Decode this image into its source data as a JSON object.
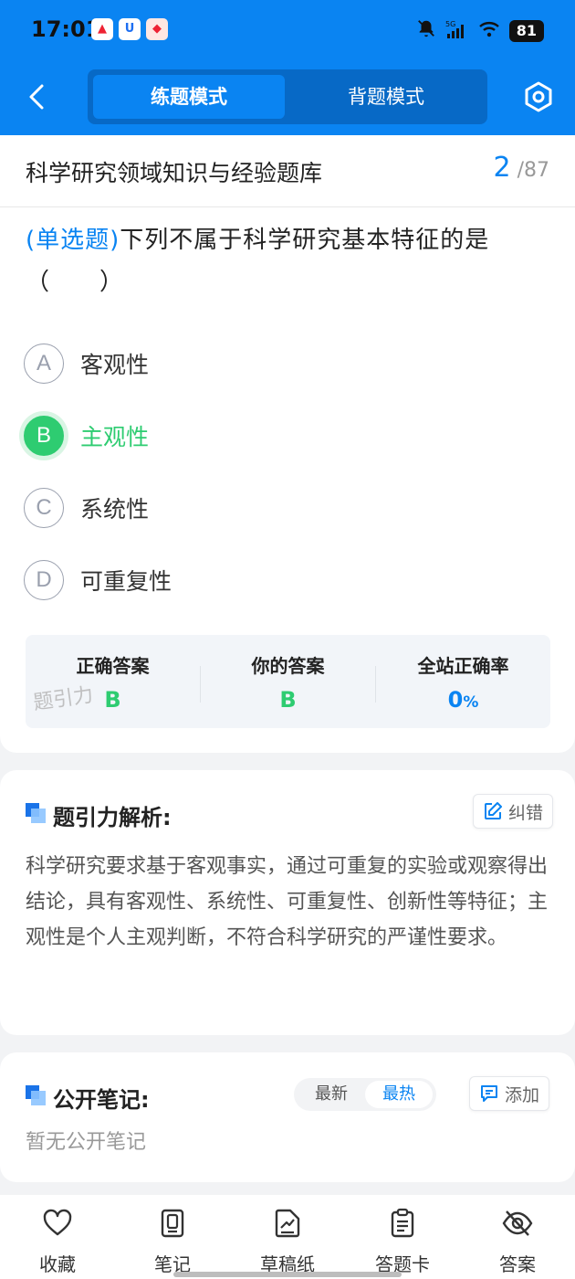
{
  "status": {
    "time": "17:01",
    "battery": "81",
    "network": "5G"
  },
  "header": {
    "tab_practice": "练题模式",
    "tab_memorize": "背题模式"
  },
  "bank": {
    "title": "科学研究领域知识与经验题库",
    "current": "2",
    "total": "87"
  },
  "question": {
    "type": "(单选题)",
    "text": "下列不属于科学研究基本特征的是（　　）",
    "options": [
      {
        "letter": "A",
        "text": "客观性"
      },
      {
        "letter": "B",
        "text": "主观性"
      },
      {
        "letter": "C",
        "text": "系统性"
      },
      {
        "letter": "D",
        "text": "可重复性"
      }
    ]
  },
  "answer": {
    "correct_label": "正确答案",
    "correct_value": "B",
    "yours_label": "你的答案",
    "yours_value": "B",
    "rate_label": "全站正确率",
    "rate_value": "0",
    "rate_unit": "%",
    "watermark": "题引力"
  },
  "analysis": {
    "title": "题引力解析:",
    "report_label": "纠错",
    "text": "科学研究要求基于客观事实，通过可重复的实验或观察得出结论，具有客观性、系统性、可重复性、创新性等特征；主观性是个人主观判断，不符合科学研究的严谨性要求。"
  },
  "notes": {
    "title": "公开笔记:",
    "tab_latest": "最新",
    "tab_hot": "最热",
    "add_label": "添加",
    "empty": "暂无公开笔记"
  },
  "bottom_nav": {
    "favorite": "收藏",
    "notes": "笔记",
    "draft": "草稿纸",
    "answer_card": "答题卡",
    "answer": "答案"
  },
  "colors": {
    "primary": "#0a84f2",
    "correct": "#2ecc71"
  }
}
